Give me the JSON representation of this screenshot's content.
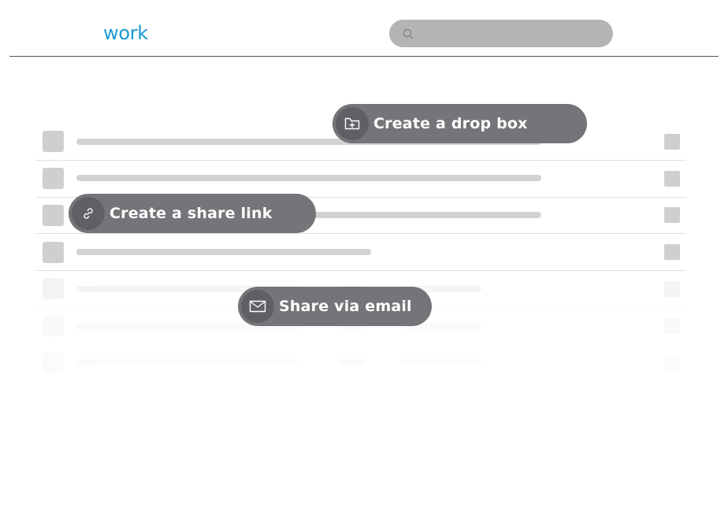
{
  "app": {
    "logo_text": "work"
  },
  "search": {
    "placeholder": ""
  },
  "actions": {
    "drop_box": {
      "label": "Create a drop box",
      "icon": "folder-plus-icon"
    },
    "share_link": {
      "label": "Create a share link",
      "icon": "link-icon"
    },
    "share_email": {
      "label": "Share via email",
      "icon": "mail-icon"
    }
  },
  "colors": {
    "brand": "#1a9ad2",
    "pill_bg": "#737578",
    "pill_icon_bg": "#5e6063"
  }
}
